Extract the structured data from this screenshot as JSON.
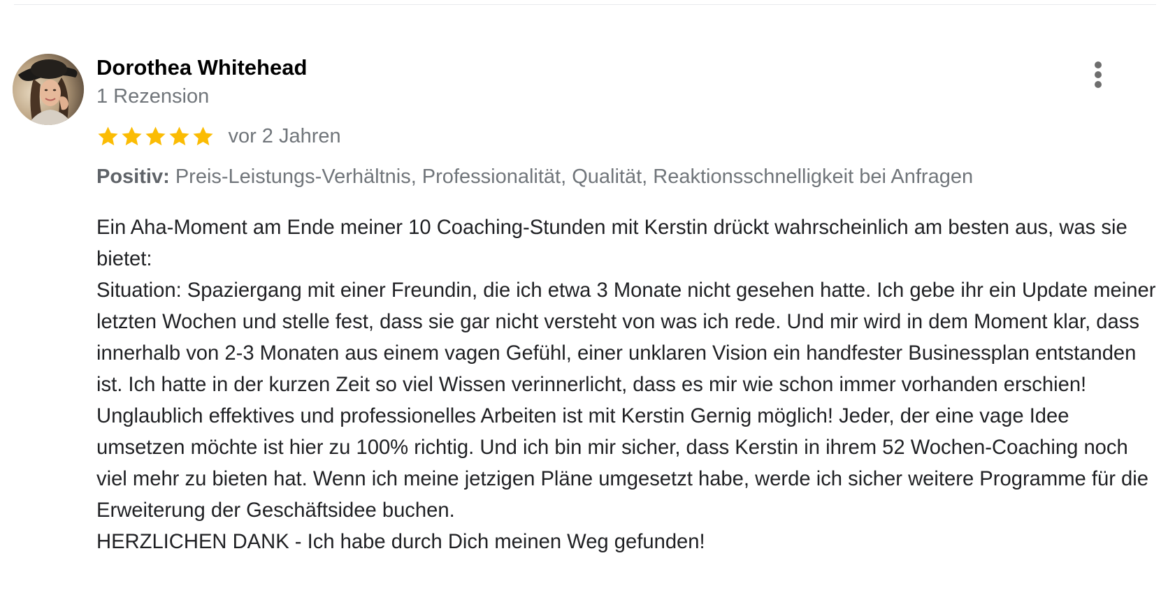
{
  "review": {
    "author": {
      "name": "Dorothea Whitehead",
      "review_count": "1 Rezension",
      "avatar_icon": "profile-photo"
    },
    "rating": {
      "stars": 5,
      "max_stars": 5,
      "star_color": "#fbbc04"
    },
    "date": "vor 2 Jahren",
    "positives": {
      "label": "Positiv:",
      "items": "Preis-Leistungs-Verhältnis, Professionalität, Qualität, Reaktionsschnelligkeit bei Anfragen"
    },
    "text": {
      "paragraph_1": "Ein Aha-Moment am Ende meiner 10 Coaching-Stunden mit Kerstin drückt wahrscheinlich am besten aus, was sie bietet:",
      "paragraph_2": "Situation: Spaziergang mit einer Freundin, die ich etwa 3 Monate nicht gesehen hatte. Ich gebe ihr ein Update meiner letzten Wochen und stelle fest, dass sie gar nicht versteht von was ich rede. Und mir wird in dem Moment klar, dass innerhalb von 2-3 Monaten aus einem vagen Gefühl, einer unklaren Vision ein handfester Businessplan entstanden ist. Ich hatte in der kurzen Zeit so viel Wissen verinnerlicht, dass es mir wie schon immer vorhanden erschien! Unglaublich effektives und professionelles Arbeiten ist mit Kerstin Gernig möglich! Jeder, der eine vage Idee umsetzen möchte ist hier zu 100% richtig. Und ich bin mir sicher, dass Kerstin in ihrem 52 Wochen-Coaching noch viel mehr zu bieten hat. Wenn ich meine jetzigen Pläne umgesetzt habe, werde ich sicher weitere Programme für die Erweiterung der Geschäftsidee buchen.",
      "paragraph_3": "HERZLICHEN DANK - Ich habe durch Dich meinen Weg gefunden!"
    },
    "menu_icon": "more-vertical-icon"
  }
}
